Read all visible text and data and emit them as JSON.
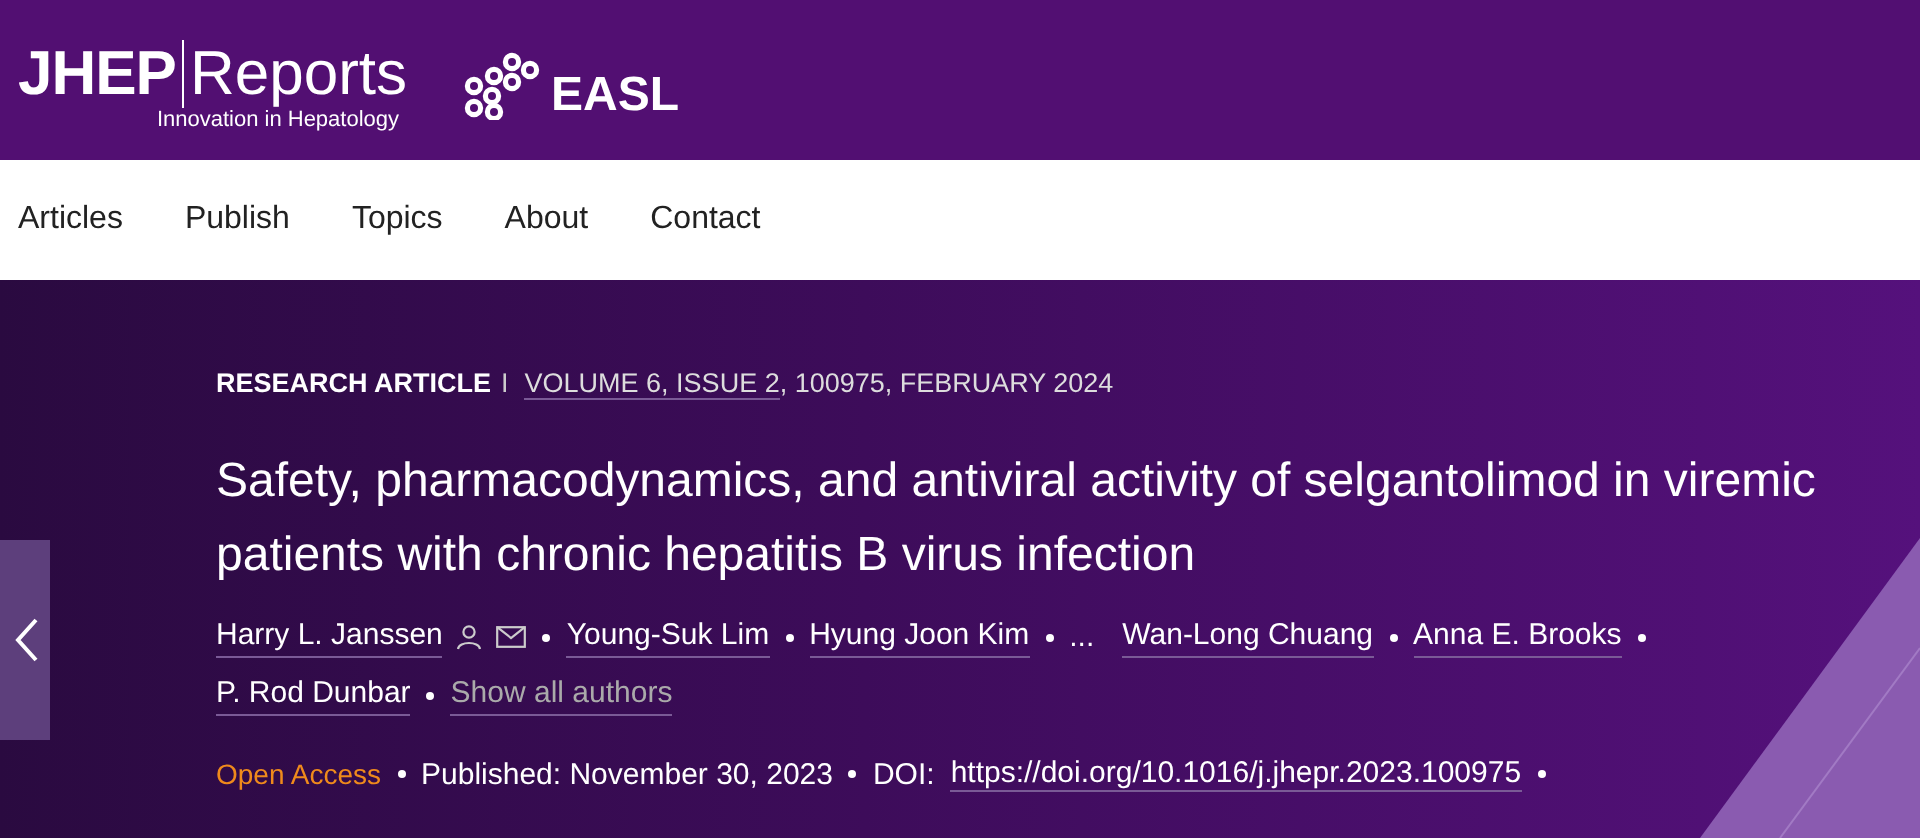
{
  "header": {
    "logo_main": "JHEP",
    "logo_sub": "Reports",
    "tagline": "Innovation in Hepatology",
    "partner": "EASL"
  },
  "nav": [
    {
      "label": "Articles"
    },
    {
      "label": "Publish"
    },
    {
      "label": "Topics"
    },
    {
      "label": "About"
    },
    {
      "label": "Contact"
    }
  ],
  "article": {
    "type": "RESEARCH ARTICLE",
    "separator": "I",
    "volume": "VOLUME 6, ISSUE 2",
    "details": ", 100975, FEBRUARY 2024",
    "title": "Safety, pharmacodynamics, and antiviral activity of selgantolimod in viremic patients with chronic hepatitis B virus infection",
    "authors": [
      {
        "name": "Harry L. Janssen",
        "kind": "corresponding"
      },
      {
        "name": "Young-Suk Lim",
        "kind": "author"
      },
      {
        "name": "Hyung Joon Kim",
        "kind": "author"
      },
      {
        "name": "...",
        "kind": "ellipsis"
      },
      {
        "name": "Wan-Long Chuang",
        "kind": "author"
      },
      {
        "name": "Anna E. Brooks",
        "kind": "author"
      },
      {
        "name": "P. Rod Dunbar",
        "kind": "author"
      }
    ],
    "show_all": "Show all authors",
    "access": "Open Access",
    "published": "Published: November 30, 2023",
    "doi_label": "DOI:",
    "doi": "https://doi.org/10.1016/j.jhepr.2023.100975"
  }
}
